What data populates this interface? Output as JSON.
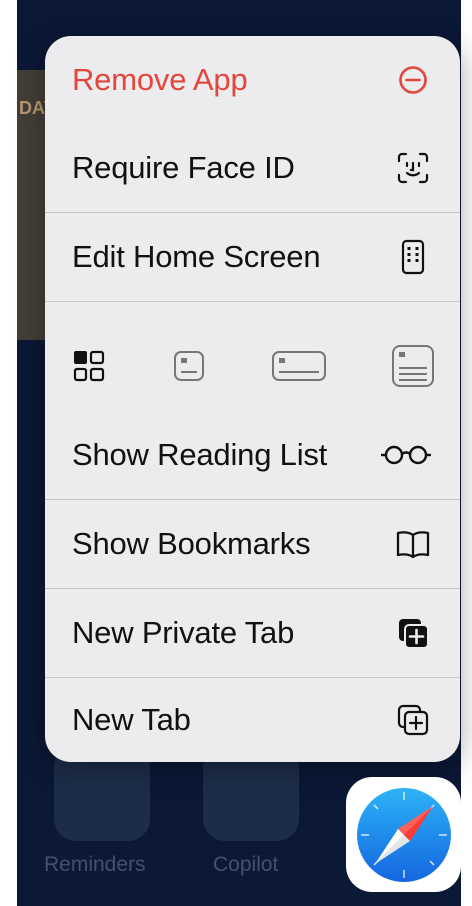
{
  "menu": {
    "remove_app": "Remove App",
    "require_face_id": "Require Face ID",
    "edit_home_screen": "Edit Home Screen",
    "show_reading_list": "Show Reading List",
    "show_bookmarks": "Show Bookmarks",
    "new_private_tab": "New Private Tab",
    "new_tab": "New Tab"
  },
  "icons": {
    "remove": "minus-circle-icon",
    "face_id": "face-id-icon",
    "edit_home": "phone-icon",
    "widget_sizes": [
      "widget-grid-icon",
      "widget-small-icon",
      "widget-medium-icon",
      "widget-large-icon"
    ],
    "reading_list": "glasses-icon",
    "bookmarks": "book-icon",
    "private_tab": "private-tab-icon",
    "new_tab": "new-tab-icon"
  },
  "background": {
    "widget_text": "DAY",
    "dock_labels": [
      "Reminders",
      "Copilot"
    ]
  },
  "colors": {
    "destructive": "#e4463a",
    "menu_bg": "#ececef",
    "backdrop": "#0b1836",
    "safari_blue": "#1e8ff2"
  }
}
